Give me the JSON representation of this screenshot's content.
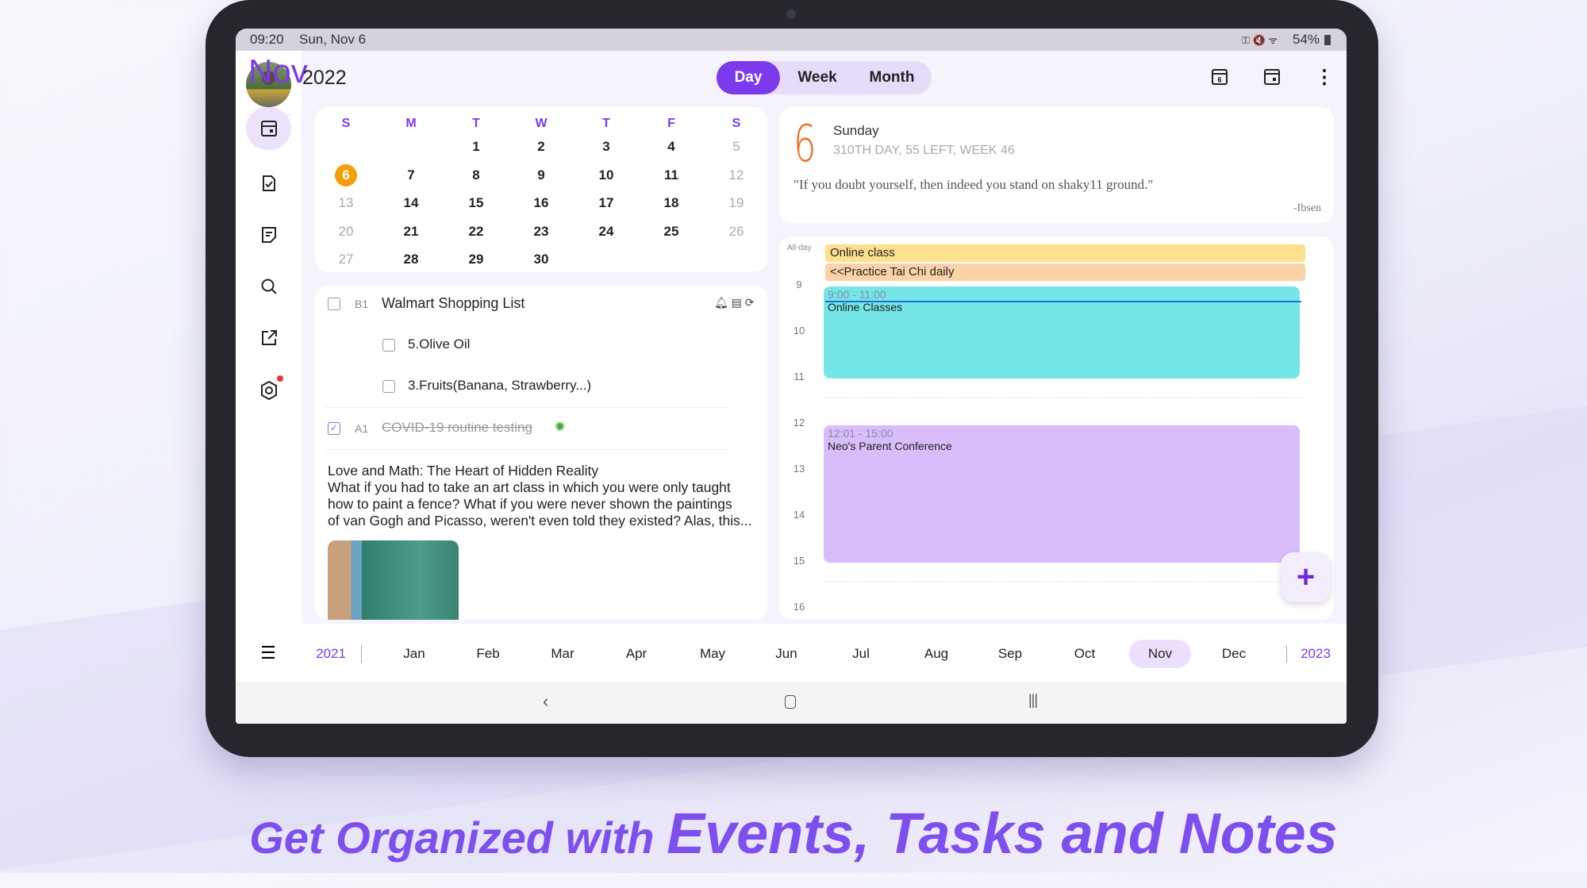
{
  "status_bar": {
    "time": "09:20",
    "date": "Sun, Nov 6",
    "battery": "54%"
  },
  "header": {
    "month": "Nov",
    "year": "2022",
    "views": [
      "Day",
      "Week",
      "Month"
    ],
    "active_view": "Day"
  },
  "calendar": {
    "weekdays": [
      "S",
      "M",
      "T",
      "W",
      "T",
      "F",
      "S"
    ],
    "weeks": [
      [
        "",
        "",
        "1",
        "2",
        "3",
        "4",
        "5"
      ],
      [
        "6",
        "7",
        "8",
        "9",
        "10",
        "11",
        "12"
      ],
      [
        "13",
        "14",
        "15",
        "16",
        "17",
        "18",
        "19"
      ],
      [
        "20",
        "21",
        "22",
        "23",
        "24",
        "25",
        "26"
      ],
      [
        "27",
        "28",
        "29",
        "30",
        "",
        "",
        ""
      ]
    ],
    "today": "6",
    "today_color": "#f59e0b"
  },
  "tasks": [
    {
      "priority": "B1",
      "title": "Walmart Shopping List",
      "done": false,
      "subtasks": [
        {
          "title": "5.Olive Oil",
          "done": false
        },
        {
          "title": "3.Fruits(Banana, Strawberry...)",
          "done": false
        }
      ]
    },
    {
      "priority": "A1",
      "title": "COVID-19 routine testing",
      "done": true
    }
  ],
  "note": {
    "title": "Love and Math: The Heart of Hidden Reality",
    "lines": [
      "What if you had to take an art class in which you were only taught",
      "how to paint a fence? What if you were never shown the paintings",
      "of van Gogh and Picasso, weren't even told they existed? Alas, this..."
    ]
  },
  "day_info": {
    "day_number": "6",
    "weekday": "Sunday",
    "summary": "310TH DAY, 55 LEFT, WEEK 46",
    "quote": "\"If you doubt yourself, then indeed you stand on shaky11 ground.\"",
    "author": "-Ibsen"
  },
  "timeline": {
    "allday_label": "All-day",
    "allday_events": [
      {
        "title": "Online class",
        "color": "#fde08e"
      },
      {
        "title": "<<Practice Tai Chi daily",
        "color": "#fdd2a6"
      }
    ],
    "hours": [
      "9",
      "10",
      "11",
      "12",
      "13",
      "14",
      "15",
      "16"
    ],
    "events": [
      {
        "time": "9:00 - 11:00",
        "title": "Online Classes",
        "color": "#74e6e8"
      },
      {
        "time": "12:01 - 15:00",
        "title": "Neo's Parent Conference",
        "color": "#d8bdfa"
      }
    ]
  },
  "month_bar": {
    "prev_year": "2021",
    "months": [
      "Jan",
      "Feb",
      "Mar",
      "Apr",
      "May",
      "Jun",
      "Jul",
      "Aug",
      "Sep",
      "Oct",
      "Nov",
      "Dec"
    ],
    "active": "Nov",
    "next_year": "2023"
  },
  "tagline": {
    "part1": "Get Organized with ",
    "part2": "Events, Tasks and Notes"
  },
  "colors": {
    "accent": "#7c3aed",
    "today": "#f59e0b"
  }
}
